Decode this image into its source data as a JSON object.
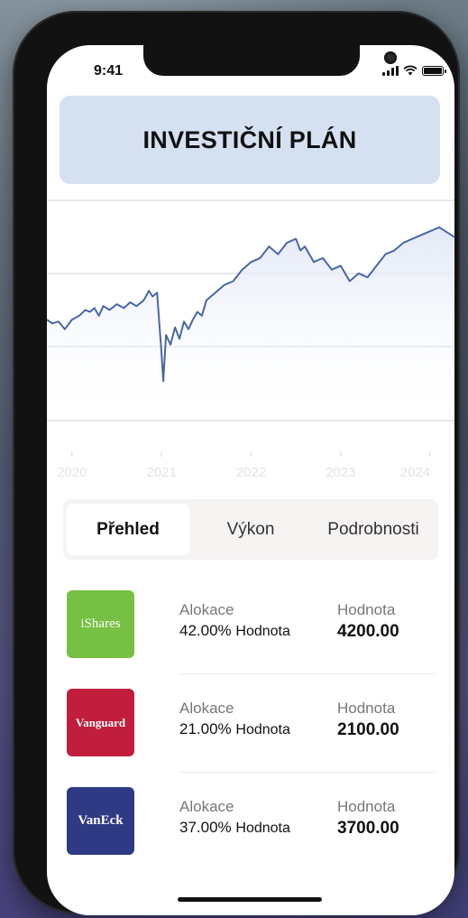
{
  "status_bar": {
    "time": "9:41"
  },
  "header": {
    "title": "INVESTIČNÍ PLÁN"
  },
  "chart_data": {
    "type": "line",
    "x_ticks": [
      "2020",
      "2021",
      "2022",
      "2023",
      "2024"
    ],
    "series_color": "#4a66a8",
    "grid": true,
    "series": [
      {
        "x": [
          2019.72,
          2019.78,
          2019.85,
          2019.92,
          2020.0,
          2020.08,
          2020.15,
          2020.2,
          2020.25,
          2020.3,
          2020.35,
          2020.42,
          2020.5,
          2020.58,
          2020.65,
          2020.72,
          2020.8,
          2020.86,
          2020.9,
          2020.95,
          2021.0,
          2021.02,
          2021.05,
          2021.1,
          2021.15,
          2021.2,
          2021.25,
          2021.3,
          2021.35,
          2021.4,
          2021.45,
          2021.5,
          2021.6,
          2021.7,
          2021.8,
          2021.9,
          2022.0,
          2022.1,
          2022.2,
          2022.3,
          2022.4,
          2022.5,
          2022.55,
          2022.6,
          2022.7,
          2022.8,
          2022.9,
          2023.0,
          2023.1,
          2023.2,
          2023.3,
          2023.4,
          2023.5,
          2023.6,
          2023.7,
          2023.8,
          2023.9,
          2024.0,
          2024.1,
          2024.2,
          2024.27
        ],
        "y": [
          0.38,
          0.36,
          0.37,
          0.33,
          0.38,
          0.4,
          0.43,
          0.42,
          0.44,
          0.4,
          0.45,
          0.43,
          0.46,
          0.44,
          0.47,
          0.45,
          0.48,
          0.53,
          0.5,
          0.52,
          0.2,
          0.06,
          0.3,
          0.25,
          0.34,
          0.28,
          0.37,
          0.33,
          0.38,
          0.42,
          0.4,
          0.48,
          0.52,
          0.56,
          0.58,
          0.64,
          0.68,
          0.7,
          0.76,
          0.72,
          0.78,
          0.8,
          0.74,
          0.76,
          0.68,
          0.7,
          0.64,
          0.66,
          0.58,
          0.62,
          0.6,
          0.66,
          0.72,
          0.74,
          0.78,
          0.8,
          0.82,
          0.84,
          0.86,
          0.83,
          0.81
        ]
      }
    ]
  },
  "tabs": [
    {
      "label": "Přehled",
      "active": true
    },
    {
      "label": "Výkon",
      "active": false
    },
    {
      "label": "Podrobnosti",
      "active": false
    }
  ],
  "funds": [
    {
      "logo_text": "iShares",
      "logo_color": "#76c043",
      "alloc_label": "Alokace",
      "alloc_pct": "42.00%",
      "alloc_suffix": "Hodnota",
      "value_label": "Hodnota",
      "value": "4200.00"
    },
    {
      "logo_text": "Vanguard",
      "logo_color": "#c01e3c",
      "alloc_label": "Alokace",
      "alloc_pct": "21.00%",
      "alloc_suffix": "Hodnota",
      "value_label": "Hodnota",
      "value": "2100.00"
    },
    {
      "logo_text": "VanEck",
      "logo_color": "#2f3a85",
      "alloc_label": "Alokace",
      "alloc_pct": "37.00%",
      "alloc_suffix": "Hodnota",
      "value_label": "Hodnota",
      "value": "3700.00"
    }
  ]
}
